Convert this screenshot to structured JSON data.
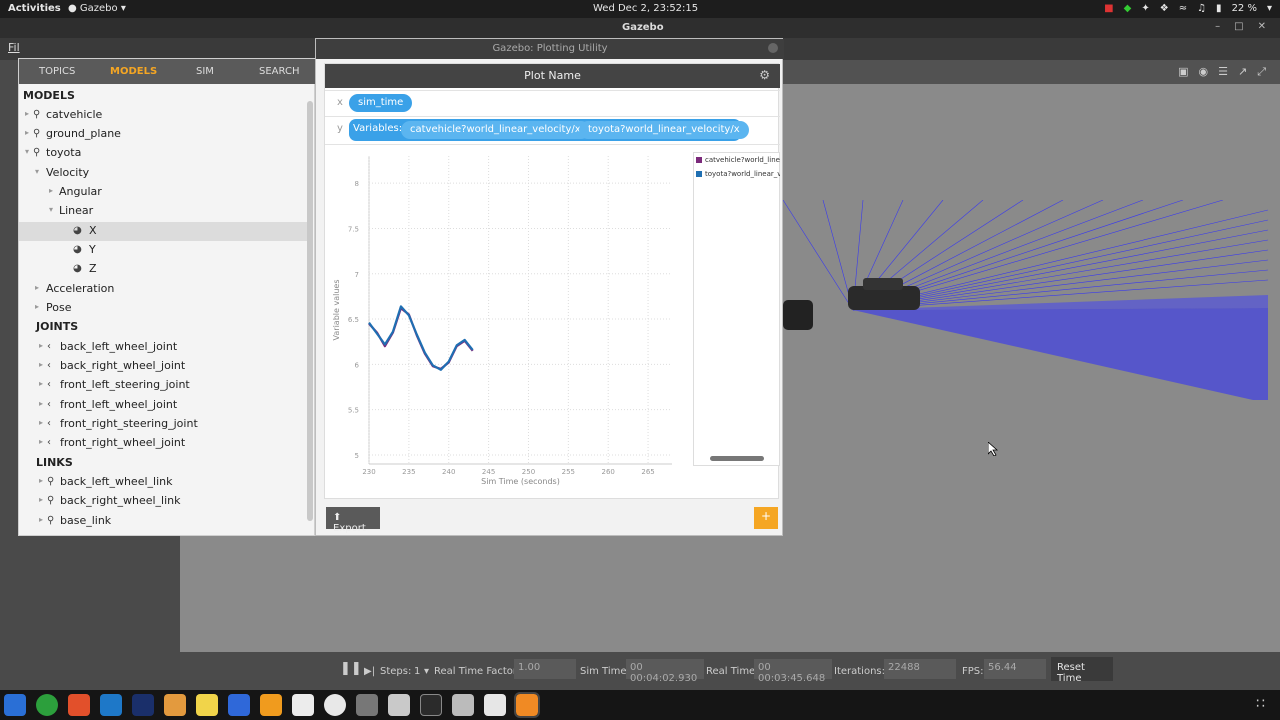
{
  "topbar": {
    "activities": "Activities",
    "app_name": "Gazebo",
    "clock": "Wed Dec  2, 23:52:15",
    "battery": "22 %"
  },
  "titlebar": {
    "title": "Gazebo"
  },
  "menubar": {
    "file_label": "Fil"
  },
  "model_panel": {
    "tabs": [
      {
        "label": "TOPICS"
      },
      {
        "label": "MODELS"
      },
      {
        "label": "SIM"
      },
      {
        "label": "SEARCH"
      }
    ],
    "tree": {
      "models_header": "MODELS",
      "models": [
        "catvehicle",
        "ground_plane",
        "toyota"
      ],
      "velocity": "Velocity",
      "angular": "Angular",
      "linear": "Linear",
      "axes": [
        "X",
        "Y",
        "Z"
      ],
      "acceleration": "Acceleration",
      "pose": "Pose",
      "joints_header": "JOINTS",
      "joints": [
        "back_left_wheel_joint",
        "back_right_wheel_joint",
        "front_left_steering_joint",
        "front_left_wheel_joint",
        "front_right_steering_joint",
        "front_right_wheel_joint"
      ],
      "links_header": "LINKS",
      "links": [
        "back_left_wheel_link",
        "back_right_wheel_link",
        "base_link"
      ]
    }
  },
  "plot_window": {
    "title": "Gazebo: Plotting Utility",
    "plot_name": "Plot Name",
    "x_label": "x",
    "x_variable": "sim_time",
    "y_label": "y",
    "variables_label": "Variables:",
    "y_variables": [
      "catvehicle?world_linear_velocity/x",
      "toyota?world_linear_velocity/x"
    ],
    "export_label": "Export",
    "add_label": "+"
  },
  "chart_data": {
    "type": "line",
    "title": "",
    "xlabel": "Sim Time (seconds)",
    "ylabel": "Variable values",
    "xlim": [
      230,
      268
    ],
    "ylim": [
      4.9,
      8.3
    ],
    "xticks": [
      230,
      235,
      240,
      245,
      250,
      255,
      260,
      265
    ],
    "yticks": [
      5,
      5.5,
      6,
      6.5,
      7,
      7.5,
      8
    ],
    "grid": true,
    "legend_position": "right",
    "series": [
      {
        "name": "catvehicle?world_linear_velocity/x",
        "color": "#7b2a7b",
        "x": [
          230,
          231,
          232,
          233,
          234,
          235,
          236,
          237,
          238,
          239,
          240,
          241,
          242,
          243
        ],
        "y": [
          6.45,
          6.35,
          6.2,
          6.35,
          6.62,
          6.55,
          6.32,
          6.12,
          5.98,
          5.95,
          6.02,
          6.2,
          6.26,
          6.15
        ]
      },
      {
        "name": "toyota?world_linear_velocity/x",
        "color": "#1f6fb2",
        "x": [
          230,
          231,
          232,
          233,
          234,
          235,
          236,
          237,
          238,
          239,
          240,
          241,
          242,
          243
        ],
        "y": [
          6.46,
          6.34,
          6.22,
          6.36,
          6.64,
          6.54,
          6.33,
          6.13,
          5.99,
          5.94,
          6.03,
          6.21,
          6.27,
          6.16
        ]
      }
    ]
  },
  "statusbar": {
    "steps_label": "Steps:",
    "steps_value": "1",
    "rtf_label": "Real Time Factor:",
    "rtf_value": "1.00",
    "sim_time_label": "Sim Time:",
    "sim_time_value": "00 00:04:02.930",
    "real_time_label": "Real Time:",
    "real_time_value": "00 00:03:45.648",
    "iterations_label": "Iterations:",
    "iterations_value": "22488",
    "fps_label": "FPS:",
    "fps_value": "56.44",
    "reset_label": "Reset Time"
  },
  "colors": {
    "accent": "#f5a623",
    "pill": "#3aa1e8",
    "lidar": "#2c2cff"
  }
}
